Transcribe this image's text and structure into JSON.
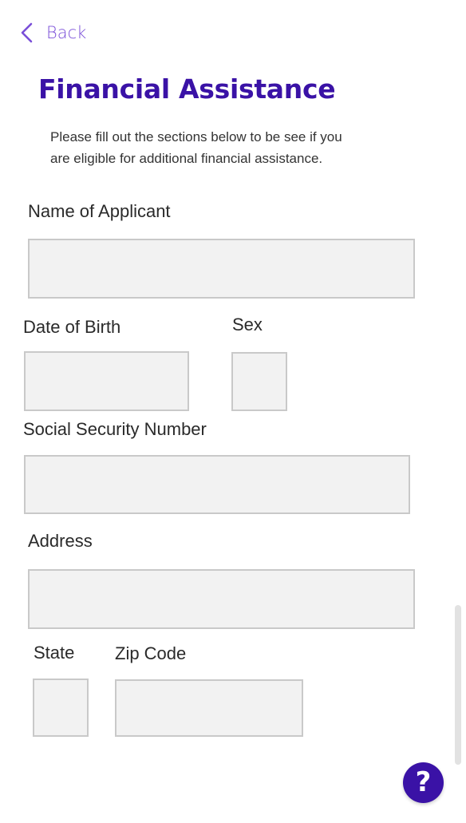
{
  "nav": {
    "back_label": "Back"
  },
  "page": {
    "title": "Financial Assistance",
    "intro": "Please fill out the sections below to be see if you\nare  eligible for additional financial assistance."
  },
  "form": {
    "name_label": "Name of Applicant",
    "name_value": "",
    "dob_label": "Date of Birth",
    "dob_value": "",
    "sex_label": "Sex",
    "sex_value": "",
    "ssn_label": "Social Security Number",
    "ssn_value": "",
    "address_label": "Address",
    "address_value": "",
    "state_label": "State",
    "state_value": "",
    "zip_label": "Zip Code",
    "zip_value": ""
  },
  "help": {
    "icon": "question-mark",
    "glyph": "?"
  },
  "colors": {
    "accent": "#3a12a6",
    "back_link": "#7a4fd8",
    "field_bg": "#f2f2f2",
    "field_border": "#c9c9c9"
  }
}
